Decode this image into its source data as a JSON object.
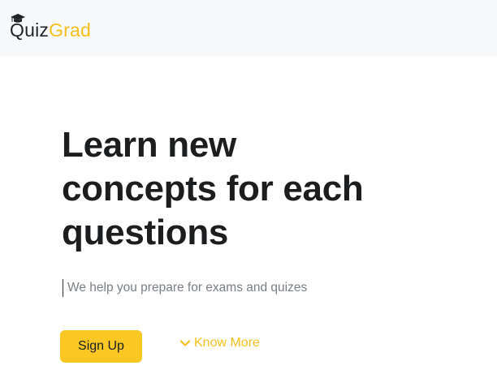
{
  "navbar": {
    "brand": {
      "part1": "Quiz",
      "part2": "Grad",
      "icon": "graduation-cap-icon"
    }
  },
  "hero": {
    "headline_lines": [
      "Learn new",
      "concepts for each",
      "questions"
    ],
    "subtitle": "We help you prepare for exams and quizes"
  },
  "actions": {
    "signup_label": "Sign Up",
    "know_more_label": "Know More",
    "know_more_icon": "chevron-down-icon"
  },
  "colors": {
    "accent": "#f4c01e",
    "button_bg": "#fbc723",
    "navbar_bg": "#f8f9fa",
    "text_dark": "#1b1d1f",
    "subtitle_gray": "#7a7f85"
  }
}
